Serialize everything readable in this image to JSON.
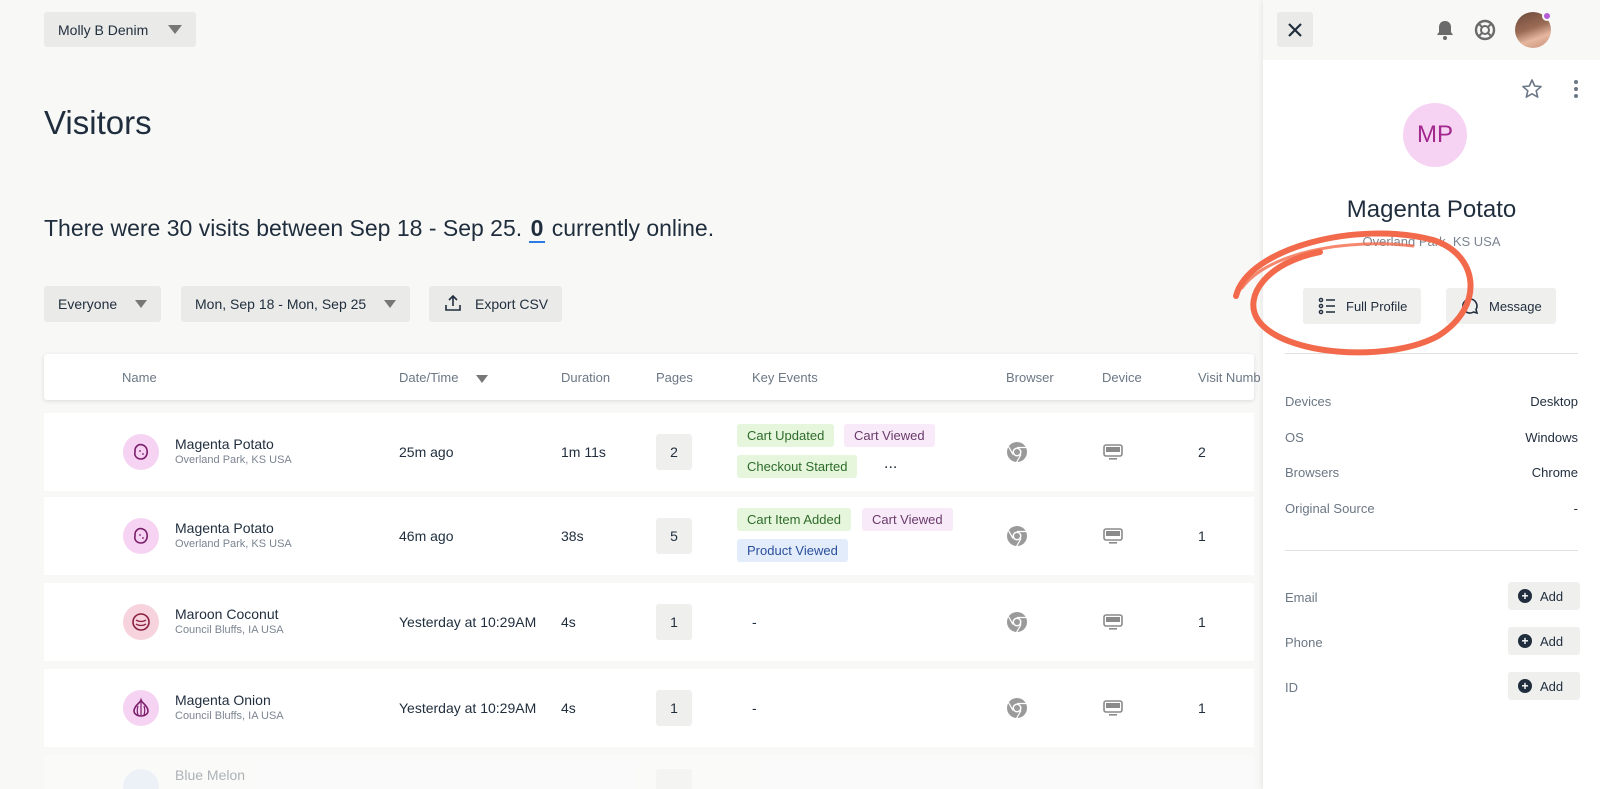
{
  "workspace": {
    "name": "Molly B Denim"
  },
  "page": {
    "title": "Visitors"
  },
  "summary": {
    "prefix": "There were 30 visits between Sep 18 - Sep 25.",
    "online_count": "0",
    "suffix": "currently online."
  },
  "filters": {
    "audience": "Everyone",
    "date_range": "Mon, Sep 18 - Mon, Sep 25",
    "export_label": "Export CSV"
  },
  "table": {
    "headers": {
      "name": "Name",
      "datetime": "Date/Time",
      "duration": "Duration",
      "pages": "Pages",
      "key_events": "Key Events",
      "browser": "Browser",
      "device": "Device",
      "visit_number": "Visit Numb"
    },
    "rows": [
      {
        "name": "Magenta Potato",
        "location": "Overland Park, KS USA",
        "datetime": "25m ago",
        "duration": "1m 11s",
        "pages": "2",
        "events": [
          "Cart Updated",
          "Cart Viewed",
          "Checkout Started"
        ],
        "more": "...",
        "visit_number": "2",
        "browser_icon": "chrome-icon",
        "device_icon": "desktop-icon"
      },
      {
        "name": "Magenta Potato",
        "location": "Overland Park, KS USA",
        "datetime": "46m ago",
        "duration": "38s",
        "pages": "5",
        "events": [
          "Cart Item Added",
          "Cart Viewed",
          "Product Viewed"
        ],
        "visit_number": "1",
        "browser_icon": "chrome-icon",
        "device_icon": "desktop-icon"
      },
      {
        "name": "Maroon Coconut",
        "location": "Council Bluffs, IA USA",
        "datetime": "Yesterday at 10:29AM",
        "duration": "4s",
        "pages": "1",
        "events_empty": "-",
        "visit_number": "1",
        "browser_icon": "chrome-icon",
        "device_icon": "desktop-icon"
      },
      {
        "name": "Magenta Onion",
        "location": "Council Bluffs, IA USA",
        "datetime": "Yesterday at 10:29AM",
        "duration": "4s",
        "pages": "1",
        "events_empty": "-",
        "visit_number": "1",
        "browser_icon": "chrome-icon",
        "device_icon": "desktop-icon"
      },
      {
        "name": "Blue Melon"
      }
    ]
  },
  "panel": {
    "initials": "MP",
    "name": "Magenta Potato",
    "location": "Overland Park, KS USA",
    "full_profile_label": "Full Profile",
    "message_label": "Message",
    "details": [
      {
        "label": "Devices",
        "value": "Desktop"
      },
      {
        "label": "OS",
        "value": "Windows"
      },
      {
        "label": "Browsers",
        "value": "Chrome"
      },
      {
        "label": "Original Source",
        "value": "-"
      }
    ],
    "contact": [
      {
        "label": "Email",
        "action": "Add"
      },
      {
        "label": "Phone",
        "action": "Add"
      },
      {
        "label": "ID",
        "action": "Add"
      }
    ]
  },
  "colors": {
    "annotation": "#f26a4b",
    "avatar_bg": "#f6d3f2",
    "avatar_text": "#a2288f",
    "notification_dot": "#b65bd8"
  }
}
